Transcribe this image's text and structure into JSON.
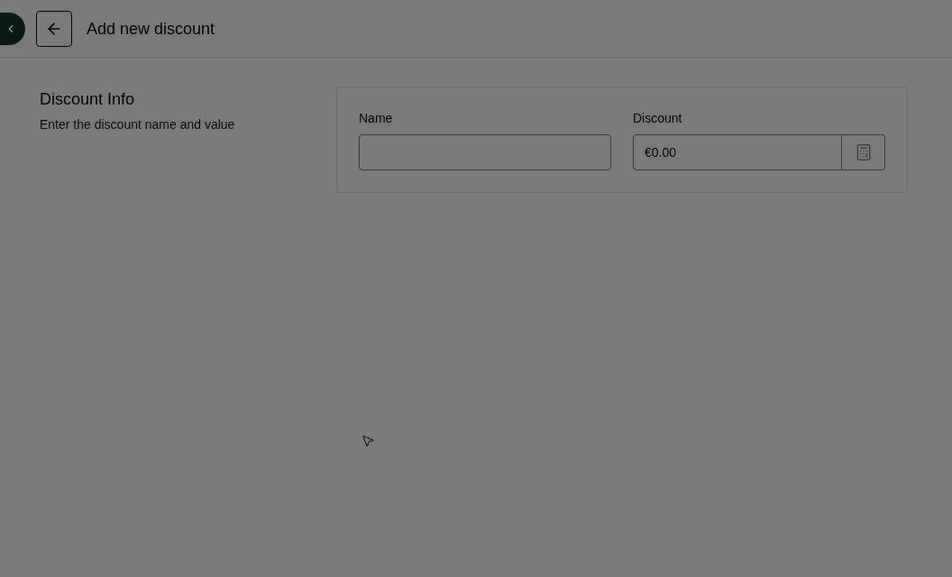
{
  "header": {
    "title": "Add new discount"
  },
  "section": {
    "title": "Discount Info",
    "subtitle": "Enter the discount name and value"
  },
  "fields": [
    {
      "kind": "text",
      "label": "Name"
    },
    {
      "kind": "amount",
      "label": "Discount",
      "value": "€0.00"
    }
  ]
}
